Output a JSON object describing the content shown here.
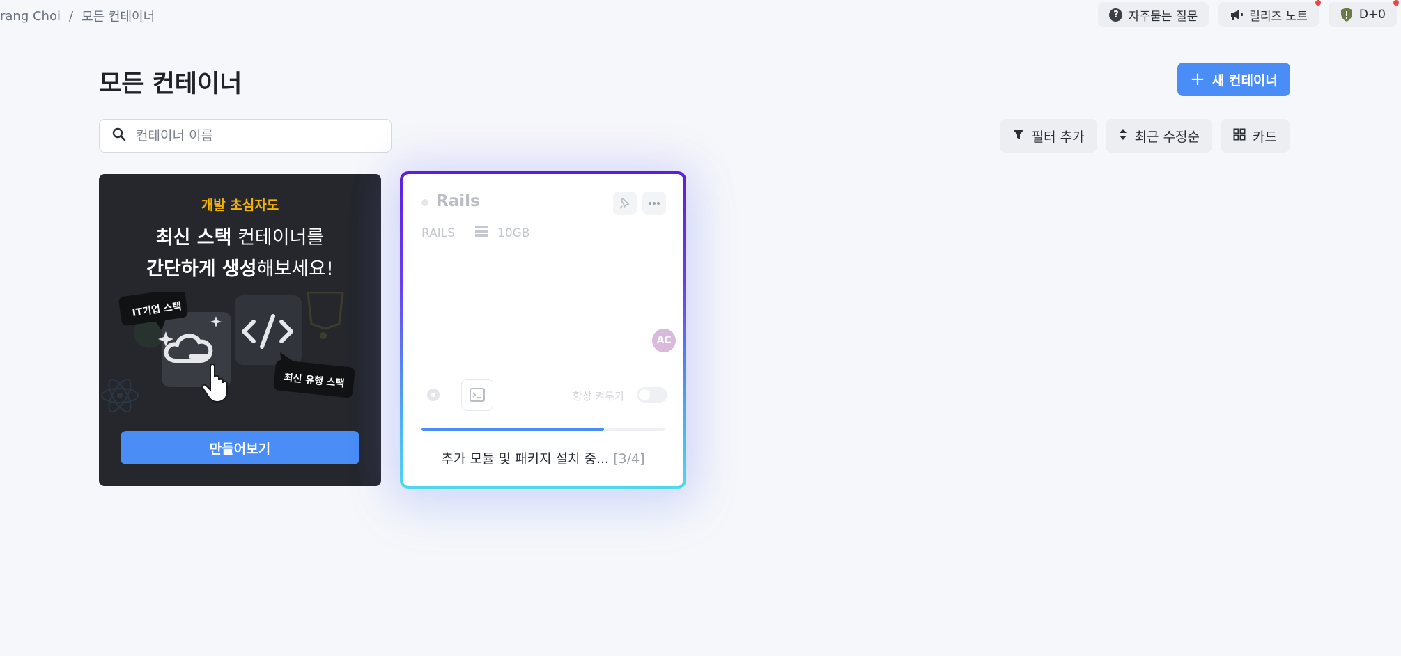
{
  "breadcrumb": {
    "user": "rang Choi",
    "separator": "/",
    "current": "모든 컨테이너"
  },
  "header_actions": {
    "faq_label": "자주묻는 질문",
    "release_notes_label": "릴리즈 노트",
    "dday_label": "D+0"
  },
  "page": {
    "title": "모든 컨테이너",
    "new_container_label": "새 컨테이너"
  },
  "search": {
    "placeholder": "컨테이너 이름",
    "value": ""
  },
  "toolbar": {
    "filter_label": "필터 추가",
    "sort_label": "최근 수정순",
    "view_label": "카드"
  },
  "promo": {
    "kicker": "개발 초심자도",
    "headline_line1_bold": "최신 스택",
    "headline_line1_rest": " 컨테이너를",
    "headline_line2_bold": "간단하게 생성",
    "headline_line2_rest": "해보세요!",
    "bubble_left": "IT기업 스택",
    "bubble_right": "최신 유행 스택",
    "cta_label": "만들어보기"
  },
  "container_card": {
    "name": "Rails",
    "stack": "RAILS",
    "storage": "10GB",
    "avatar_initials": "AC",
    "always_on_label": "항상 켜두기",
    "always_on": false,
    "progress_fraction": 0.75,
    "progress_text": "추가 모듈 및 패키지 설치 중...",
    "progress_step": "[3/4]"
  },
  "colors": {
    "accent": "#4a8df6",
    "promo_bg": "#25272d",
    "promo_kicker": "#f5b301",
    "notification_dot": "#ef4444"
  }
}
